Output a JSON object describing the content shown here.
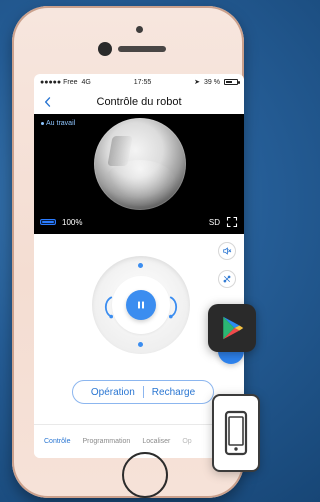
{
  "status": {
    "carrier": "●●●●● Free",
    "network": "4G",
    "time": "17:55",
    "battery_text": "39 %"
  },
  "header": {
    "title": "Contrôle du robot"
  },
  "video": {
    "mode_label": "Au travail",
    "battery_percent": "100%",
    "quality": "SD"
  },
  "controls": {
    "operation_label": "Opération",
    "recharge_label": "Recharge"
  },
  "tabs": {
    "items": [
      {
        "label": "Contrôle"
      },
      {
        "label": "Programmation"
      },
      {
        "label": "Localiser"
      },
      {
        "label": "Op"
      }
    ]
  },
  "colors": {
    "accent": "#2a76d2",
    "primary_button": "#3b8df0"
  },
  "icons": {
    "back": "chevron-left-icon",
    "fullscreen": "fullscreen-icon",
    "mute": "volume-off-icon",
    "tools": "tools-icon",
    "play_store": "play-store-icon",
    "phone_device": "phone-device-icon"
  }
}
